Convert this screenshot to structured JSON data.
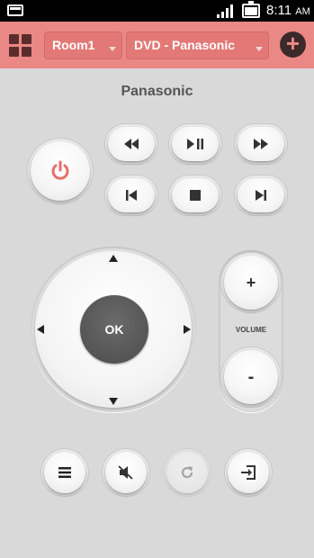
{
  "status_bar": {
    "time": "8:11",
    "ampm": "AM",
    "battery_level": 0.7
  },
  "app_bar": {
    "room_dropdown": "Room1",
    "device_dropdown": "DVD - Panasonic",
    "add_label": "+"
  },
  "device_title": "Panasonic",
  "transport": {
    "rewind": "◀◀",
    "play_pause": "▶❚❚",
    "fast_forward": "▶▶",
    "previous": "❚◀",
    "stop": "■",
    "next": "▶❚"
  },
  "dpad": {
    "ok_label": "OK"
  },
  "volume": {
    "label": "VOLUME",
    "up_label": "+",
    "down_label": "-"
  },
  "bottom_icons": [
    "menu-icon",
    "mute-icon",
    "refresh-icon",
    "input-icon"
  ],
  "colors": {
    "accent": "#ea8886",
    "power_red": "#e86e6a",
    "dark": "#3c2a2a"
  }
}
